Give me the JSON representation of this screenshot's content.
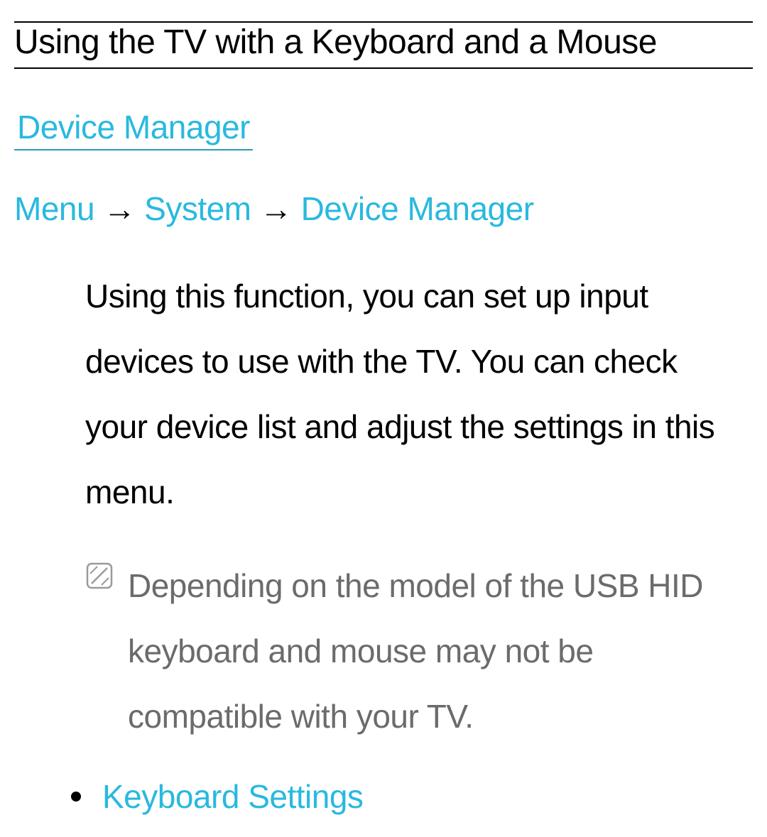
{
  "page": {
    "title": "Using the TV with a Keyboard and a Mouse",
    "section_heading": "Device Manager"
  },
  "breadcrumb": {
    "menu": "Menu",
    "system": "System",
    "device_manager": "Device Manager",
    "arrow": "→"
  },
  "body": {
    "paragraph": "Using this function, you can set up input devices to use with the TV. You can check your device list and adjust the settings in this menu.",
    "note": "Depending on the model of the USB HID keyboard and mouse may not be compatible with your TV."
  },
  "list": {
    "item1": "Keyboard Settings"
  },
  "colors": {
    "link": "#29b9df",
    "text": "#000000",
    "note": "#6b6b6b"
  }
}
